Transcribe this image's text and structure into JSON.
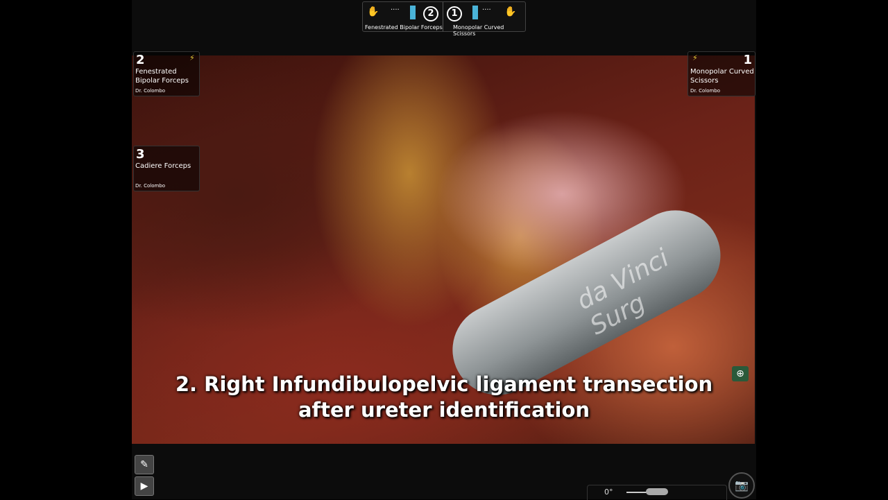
{
  "top_bar": {
    "left_arm": "2",
    "left_tool": "Fenestrated Bipolar Forceps",
    "right_arm": "1",
    "right_tool": "Monopolar Curved Scissors"
  },
  "arms": [
    {
      "number": "2",
      "tool": "Fenestrated Bipolar Forceps",
      "surgeon": "Dr. Colombo"
    },
    {
      "number": "1",
      "tool": "Monopolar Curved Scissors",
      "surgeon": "Dr. Colombo"
    },
    {
      "number": "3",
      "tool": "Cadiere Forceps",
      "surgeon": "Dr. Colombo"
    }
  ],
  "caption": {
    "line1": "2. Right Infundibulopelvic ligament transection",
    "line2": "after ureter identification"
  },
  "instrument_label": "da Vinci Surg",
  "camera": {
    "angle": "0°"
  },
  "colors": {
    "energy": "#e8d23a"
  }
}
